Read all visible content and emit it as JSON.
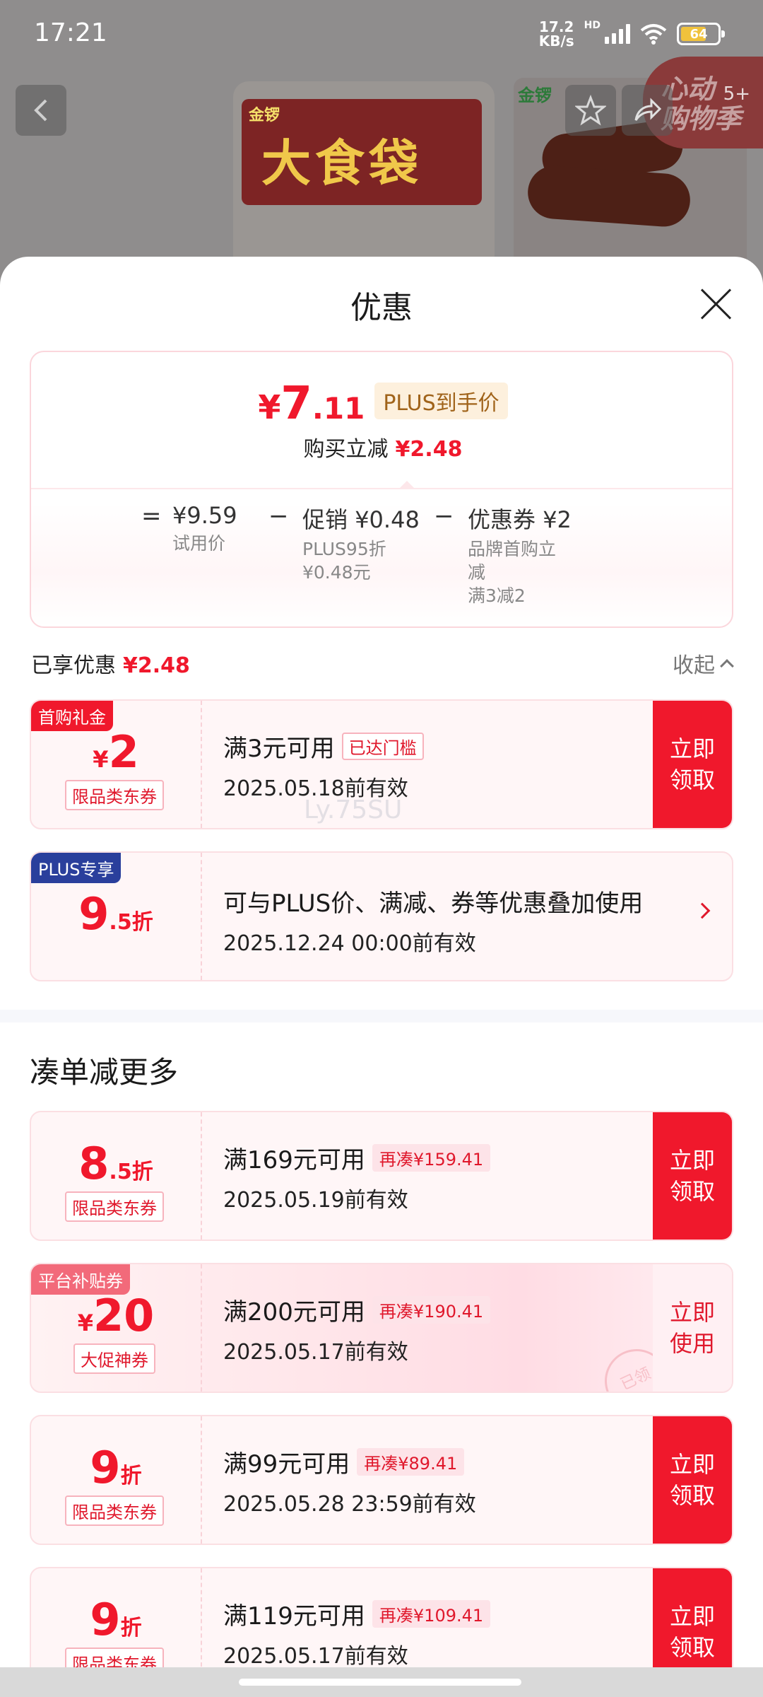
{
  "status_bar": {
    "time": "17:21",
    "net_speed_value": "17.2",
    "net_speed_unit": "KB/s",
    "hd": "HD",
    "battery": "64"
  },
  "background": {
    "brand": "金锣",
    "product_title": "大食袋",
    "promo_line1": "心动",
    "promo_line2": "购物季",
    "promo_count": "5+"
  },
  "sheet": {
    "title": "优惠",
    "price": {
      "currency": "¥",
      "integer": "7",
      "decimal": ".11",
      "tag": "PLUS到手价",
      "save_label": "购买立减",
      "save_amount": "¥2.48"
    },
    "breakdown": {
      "equals": "=",
      "minus": "−",
      "trial_price": "¥9.59",
      "trial_label": "试用价",
      "promo_label": "促销",
      "promo_amount": "¥0.48",
      "promo_sub1": "PLUS95折",
      "promo_sub2": "¥0.48元",
      "coupon_label": "优惠券",
      "coupon_amount": "¥2",
      "coupon_sub1": "品牌首购立",
      "coupon_sub2": "减",
      "coupon_sub3": "满3减2"
    },
    "enjoyed": {
      "label": "已享优惠",
      "amount": "¥2.48",
      "collapse": "收起"
    },
    "watermark": "Ly.75SU",
    "coupons_enjoyed": [
      {
        "corner": "首购礼金",
        "currency": "¥",
        "value": "2",
        "type": "限品类东券",
        "title": "满3元可用",
        "tag": "已达门槛",
        "expire": "2025.05.18前有效",
        "button": "立即领取"
      },
      {
        "corner": "PLUS专享",
        "value": "9",
        "unit": ".5折",
        "title": "可与PLUS价、满减、券等优惠叠加使用",
        "expire": "2025.12.24 00:00前有效"
      }
    ],
    "more_section_title": "凑单减更多",
    "coupons_more": [
      {
        "value": "8",
        "unit": ".5折",
        "type": "限品类东券",
        "title": "满169元可用",
        "tag": "再凑¥159.41",
        "expire": "2025.05.19前有效",
        "button": "立即领取"
      },
      {
        "corner": "平台补贴券",
        "currency": "¥",
        "value": "20",
        "type": "大促神券",
        "title": "满200元可用",
        "tag": "再凑¥190.41",
        "expire": "2025.05.17前有效",
        "button": "立即使用",
        "stamp": "已领"
      },
      {
        "value": "9",
        "unit": "折",
        "type": "限品类东券",
        "title": "满99元可用",
        "tag": "再凑¥89.41",
        "expire": "2025.05.28 23:59前有效",
        "button": "立即领取"
      },
      {
        "value": "9",
        "unit": "折",
        "type": "限品类东券",
        "title": "满119元可用",
        "tag": "再凑¥109.41",
        "expire": "2025.05.17前有效",
        "button": "立即领取"
      }
    ]
  },
  "colors": {
    "accent": "#f0182c",
    "plus_blue": "#2a3f9c",
    "plus_tag_bg": "#fdf0dd"
  }
}
